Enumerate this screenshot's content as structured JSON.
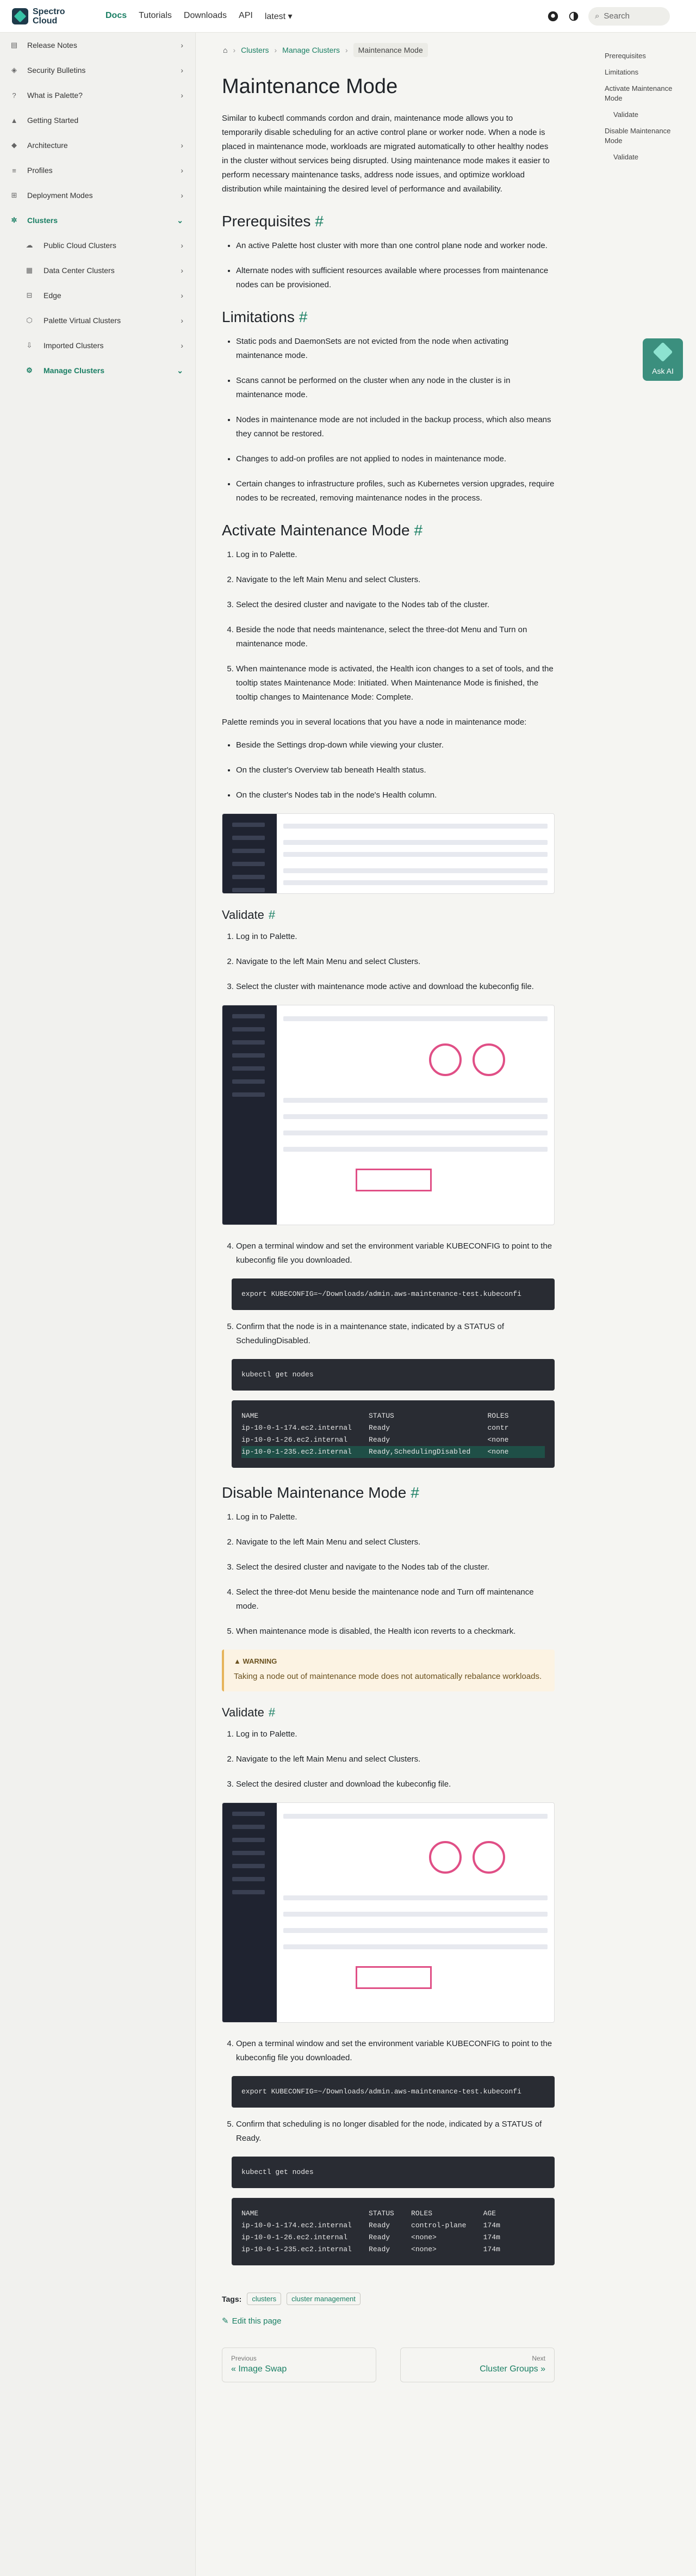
{
  "logo": {
    "line1": "Spectro",
    "line2": "Cloud"
  },
  "nav": [
    "Docs",
    "Tutorials",
    "Downloads",
    "API",
    "latest ▾"
  ],
  "search": "Search",
  "sidebar": [
    "Release Notes",
    "Security Bulletins",
    "What is Palette?",
    "Getting Started",
    "Architecture",
    "Profiles",
    "Deployment Modes",
    "Clusters",
    "Public Cloud Clusters",
    "Data Center Clusters",
    "Edge",
    "Palette Virtual Clusters",
    "Imported Clusters",
    "Manage Clusters"
  ],
  "crumbs": [
    "Clusters",
    "Manage Clusters",
    "Maintenance Mode"
  ],
  "title": "Maintenance Mode",
  "intro": "Similar to kubectl commands cordon and drain, maintenance mode allows you to temporarily disable scheduling for an active control plane or worker node. When a node is placed in maintenance mode, workloads are migrated automatically to other healthy nodes in the cluster without services being disrupted. Using maintenance mode makes it easier to perform necessary maintenance tasks, address node issues, and optimize workload distribution while maintaining the desired level of performance and availability.",
  "h_prereq": "Prerequisites",
  "prereq": [
    "An active Palette host cluster with more than one control plane node and worker node.",
    "Alternate nodes with sufficient resources available where processes from maintenance nodes can be provisioned."
  ],
  "h_limits": "Limitations",
  "limits": [
    "Static pods and DaemonSets are not evicted from the node when activating maintenance mode.",
    "Scans cannot be performed on the cluster when any node in the cluster is in maintenance mode.",
    "Nodes in maintenance mode are not included in the backup process, which also means they cannot be restored.",
    "Changes to add-on profiles are not applied to nodes in maintenance mode.",
    "Certain changes to infrastructure profiles, such as Kubernetes version upgrades, require nodes to be recreated, removing maintenance nodes in the process."
  ],
  "h_activate": "Activate Maintenance Mode",
  "activate": [
    "Log in to Palette.",
    "Navigate to the left Main Menu and select Clusters.",
    "Select the desired cluster and navigate to the Nodes tab of the cluster.",
    "Beside the node that needs maintenance, select the three-dot Menu and Turn on maintenance mode.",
    "When maintenance mode is activated, the Health icon changes to a set of tools, and the tooltip states Maintenance Mode: Initiated. When Maintenance Mode is finished, the tooltip changes to Maintenance Mode: Complete."
  ],
  "remind": "Palette reminds you in several locations that you have a node in maintenance mode:",
  "reminders": [
    "Beside the Settings drop-down while viewing your cluster.",
    "On the cluster's Overview tab beneath Health status.",
    "On the cluster's Nodes tab in the node's Health column."
  ],
  "h_validate": "Validate",
  "validate1": [
    "Log in to Palette.",
    "Navigate to the left Main Menu and select Clusters.",
    "Select the cluster with maintenance mode active and download the kubeconfig file."
  ],
  "validate1b": [
    "Open a terminal window and set the environment variable KUBECONFIG to point to the kubeconfig file you downloaded.",
    "Confirm that the node is in a maintenance state, indicated by a STATUS of SchedulingDisabled."
  ],
  "code_export1": "export KUBECONFIG=~/Downloads/admin.aws-maintenance-test.kubeconfi",
  "code_get": "kubectl get nodes",
  "nodes1": [
    "NAME                          STATUS                      ROLES",
    "ip-10-0-1-174.ec2.internal    Ready                       contr",
    "ip-10-0-1-26.ec2.internal     Ready                       <none",
    "ip-10-0-1-235.ec2.internal    Ready,SchedulingDisabled    <none"
  ],
  "h_disable": "Disable Maintenance Mode",
  "disable": [
    "Log in to Palette.",
    "Navigate to the left Main Menu and select Clusters.",
    "Select the desired cluster and navigate to the Nodes tab of the cluster.",
    "Select the three-dot Menu beside the maintenance node and Turn off maintenance mode.",
    "When maintenance mode is disabled, the Health icon reverts to a checkmark."
  ],
  "warn_title": "WARNING",
  "warn_text": "Taking a node out of maintenance mode does not automatically rebalance workloads.",
  "validate2": [
    "Log in to Palette.",
    "Navigate to the left Main Menu and select Clusters.",
    "Select the desired cluster and download the kubeconfig file."
  ],
  "validate2b": [
    "Open a terminal window and set the environment variable KUBECONFIG to point to the kubeconfig file you downloaded.",
    "Confirm that scheduling is no longer disabled for the node, indicated by a STATUS of Ready."
  ],
  "code_export2": "export KUBECONFIG=~/Downloads/admin.aws-maintenance-test.kubeconfi",
  "nodes2": [
    "NAME                          STATUS    ROLES            AGE",
    "ip-10-0-1-174.ec2.internal    Ready     control-plane    174m",
    "ip-10-0-1-26.ec2.internal     Ready     <none>           174m",
    "ip-10-0-1-235.ec2.internal    Ready     <none>           174m"
  ],
  "tags_label": "Tags:",
  "tags": [
    "clusters",
    "cluster management"
  ],
  "edit": "Edit this page",
  "prev": {
    "s": "Previous",
    "b": "« Image Swap"
  },
  "next": {
    "s": "Next",
    "b": "Cluster Groups »"
  },
  "toc": [
    "Prerequisites",
    "Limitations",
    "Activate Maintenance Mode",
    "Validate",
    "Disable Maintenance Mode",
    "Validate"
  ],
  "askai": "Ask AI"
}
